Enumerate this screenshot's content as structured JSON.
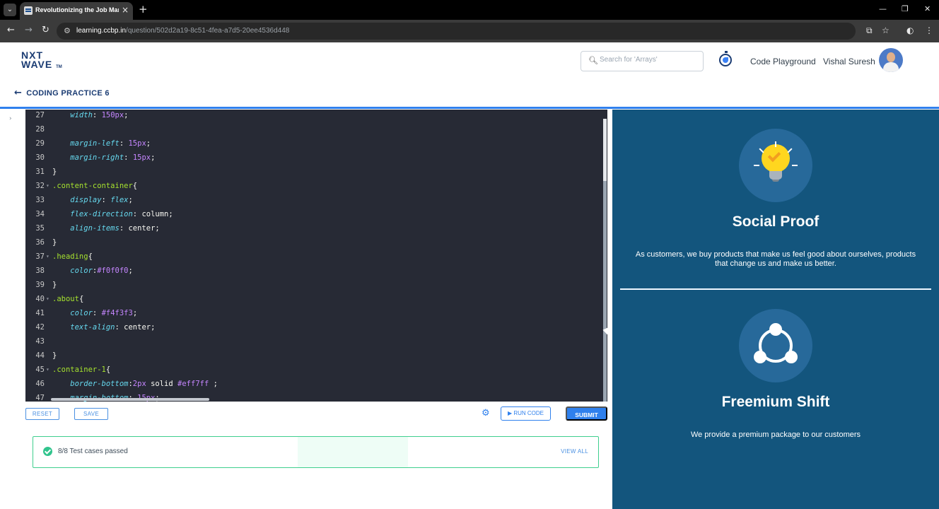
{
  "browser": {
    "tab_title": "Revolutionizing the Job Market",
    "tab_close": "×",
    "new_tab": "+",
    "url_domain": "learning.ccbp.in",
    "url_path": "/question/502d2a19-8c51-4fea-a7d5-20ee4536d448",
    "win_minimize": "—",
    "win_restore": "❐",
    "win_close": "✕"
  },
  "header": {
    "logo_line1": "NXT",
    "logo_line2": "WAVE",
    "logo_tm": "TM",
    "search_placeholder": "Search for 'Arrays'",
    "code_playground": "Code Playground",
    "user_name": "Vishal Suresh",
    "back_label": "CODING PRACTICE 6"
  },
  "editor": {
    "lines": [
      {
        "n": "27",
        "fold": "",
        "parts": [
          [
            "c-prop",
            "    width"
          ],
          [
            "c-white",
            ": "
          ],
          [
            "c-num",
            "150px"
          ],
          [
            "c-white",
            ";"
          ]
        ]
      },
      {
        "n": "28",
        "fold": "",
        "parts": []
      },
      {
        "n": "29",
        "fold": "",
        "parts": [
          [
            "c-prop",
            "    margin-left"
          ],
          [
            "c-white",
            ": "
          ],
          [
            "c-num",
            "15px"
          ],
          [
            "c-white",
            ";"
          ]
        ]
      },
      {
        "n": "30",
        "fold": "",
        "parts": [
          [
            "c-prop",
            "    margin-right"
          ],
          [
            "c-white",
            ": "
          ],
          [
            "c-num",
            "15px"
          ],
          [
            "c-white",
            ";"
          ]
        ]
      },
      {
        "n": "31",
        "fold": "",
        "parts": [
          [
            "c-white",
            "}"
          ]
        ]
      },
      {
        "n": "32",
        "fold": "▾",
        "parts": [
          [
            "c-sel",
            ".content-container"
          ],
          [
            "c-white",
            "{"
          ]
        ]
      },
      {
        "n": "33",
        "fold": "",
        "parts": [
          [
            "c-prop",
            "    display"
          ],
          [
            "c-white",
            ": "
          ],
          [
            "c-kw",
            "flex"
          ],
          [
            "c-white",
            ";"
          ]
        ]
      },
      {
        "n": "34",
        "fold": "",
        "parts": [
          [
            "c-prop",
            "    flex-direction"
          ],
          [
            "c-white",
            ": column;"
          ]
        ]
      },
      {
        "n": "35",
        "fold": "",
        "parts": [
          [
            "c-prop",
            "    align-items"
          ],
          [
            "c-white",
            ": center;"
          ]
        ]
      },
      {
        "n": "36",
        "fold": "",
        "parts": [
          [
            "c-white",
            "}"
          ]
        ]
      },
      {
        "n": "37",
        "fold": "▾",
        "parts": [
          [
            "c-sel",
            ".heading"
          ],
          [
            "c-white",
            "{"
          ]
        ]
      },
      {
        "n": "38",
        "fold": "",
        "parts": [
          [
            "c-prop",
            "    color"
          ],
          [
            "c-white",
            ":"
          ],
          [
            "c-num",
            "#f0f0f0"
          ],
          [
            "c-white",
            ";"
          ]
        ]
      },
      {
        "n": "39",
        "fold": "",
        "parts": [
          [
            "c-white",
            "}"
          ]
        ]
      },
      {
        "n": "40",
        "fold": "▾",
        "parts": [
          [
            "c-sel",
            ".about"
          ],
          [
            "c-white",
            "{"
          ]
        ]
      },
      {
        "n": "41",
        "fold": "",
        "parts": [
          [
            "c-prop",
            "    color"
          ],
          [
            "c-white",
            ": "
          ],
          [
            "c-num",
            "#f4f3f3"
          ],
          [
            "c-white",
            ";"
          ]
        ]
      },
      {
        "n": "42",
        "fold": "",
        "parts": [
          [
            "c-prop",
            "    text-align"
          ],
          [
            "c-white",
            ": center;"
          ]
        ]
      },
      {
        "n": "43",
        "fold": "",
        "parts": []
      },
      {
        "n": "44",
        "fold": "",
        "parts": [
          [
            "c-white",
            "}"
          ]
        ]
      },
      {
        "n": "45",
        "fold": "▾",
        "parts": [
          [
            "c-sel",
            ".container-1"
          ],
          [
            "c-white",
            "{"
          ]
        ]
      },
      {
        "n": "46",
        "fold": "",
        "parts": [
          [
            "c-prop",
            "    border-bottom"
          ],
          [
            "c-white",
            ":"
          ],
          [
            "c-num",
            "2px"
          ],
          [
            "c-white",
            " solid "
          ],
          [
            "c-num",
            "#eff7ff"
          ],
          [
            "c-white",
            " ;"
          ]
        ]
      },
      {
        "n": "47",
        "fold": "",
        "parts": [
          [
            "c-prop",
            "    margin-bottom"
          ],
          [
            "c-white",
            ": "
          ],
          [
            "c-num",
            "15px"
          ],
          [
            "c-white",
            ";"
          ]
        ]
      }
    ]
  },
  "toolbar": {
    "reset": "RESET",
    "save": "SAVE",
    "run_code": "▶ RUN CODE",
    "submit": "SUBMIT"
  },
  "tests": {
    "status": "8/8 Test cases passed",
    "view_all": "VIEW ALL"
  },
  "preview": {
    "cards": [
      {
        "icon": "lightbulb-icon",
        "heading": "Social Proof",
        "about": "As customers, we buy products that make us feel good about ourselves, products that change us and make us better."
      },
      {
        "icon": "share-icon",
        "heading": "Freemium Shift",
        "about": "We provide a premium package to our customers"
      }
    ]
  },
  "colors": {
    "editor_bg": "#272a35",
    "preview_bg": "#13557d",
    "icon_circle": "#27699a",
    "accent_blue": "#2f80ed",
    "success_green": "#31c48d"
  }
}
